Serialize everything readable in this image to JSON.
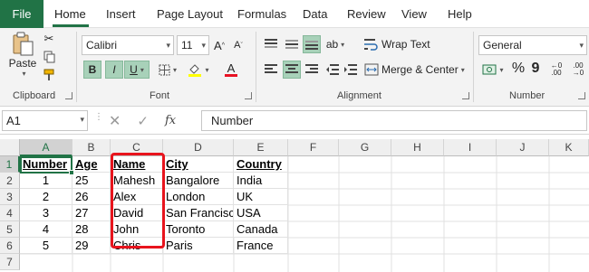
{
  "tabs": {
    "file": "File",
    "items": [
      "Home",
      "Insert",
      "Page Layout",
      "Formulas",
      "Data",
      "Review",
      "View",
      "Help"
    ],
    "active": "Home"
  },
  "ribbon": {
    "clipboard": {
      "paste_label": "Paste",
      "group_label": "Clipboard"
    },
    "font": {
      "family": "Calibri",
      "size": "11",
      "bold": "B",
      "underline": "U",
      "font_color_glyph": "A",
      "group_label": "Font",
      "highlight_color": "#ffff00",
      "font_color": "#e81123"
    },
    "alignment": {
      "wrap_text": "Wrap Text",
      "merge_center": "Merge & Center",
      "group_label": "Alignment"
    },
    "number": {
      "format": "General",
      "percent": "%",
      "comma": "9",
      "group_label": "Number"
    }
  },
  "formula_bar": {
    "name_box": "A1",
    "fx": "fx",
    "content": "Number"
  },
  "sheet": {
    "columns": [
      "A",
      "B",
      "C",
      "D",
      "E",
      "F",
      "G",
      "H",
      "I",
      "J",
      "K"
    ],
    "rows": [
      "1",
      "2",
      "3",
      "4",
      "5",
      "6",
      "7"
    ],
    "header": [
      "Number",
      "Age",
      "Name",
      "City",
      "Country"
    ],
    "data": [
      [
        "1",
        "25",
        "Mahesh",
        "Bangalore",
        "India"
      ],
      [
        "2",
        "26",
        "Alex",
        "London",
        "UK"
      ],
      [
        "3",
        "27",
        "David",
        "San Francisco",
        "USA"
      ],
      [
        "4",
        "28",
        "John",
        "Toronto",
        "Canada"
      ],
      [
        "5",
        "29",
        "Chris",
        "Paris",
        "France"
      ]
    ]
  },
  "colors": {
    "accent": "#217346",
    "selected_button": "#a8d1b9",
    "highlight_border": "#e8141d"
  }
}
